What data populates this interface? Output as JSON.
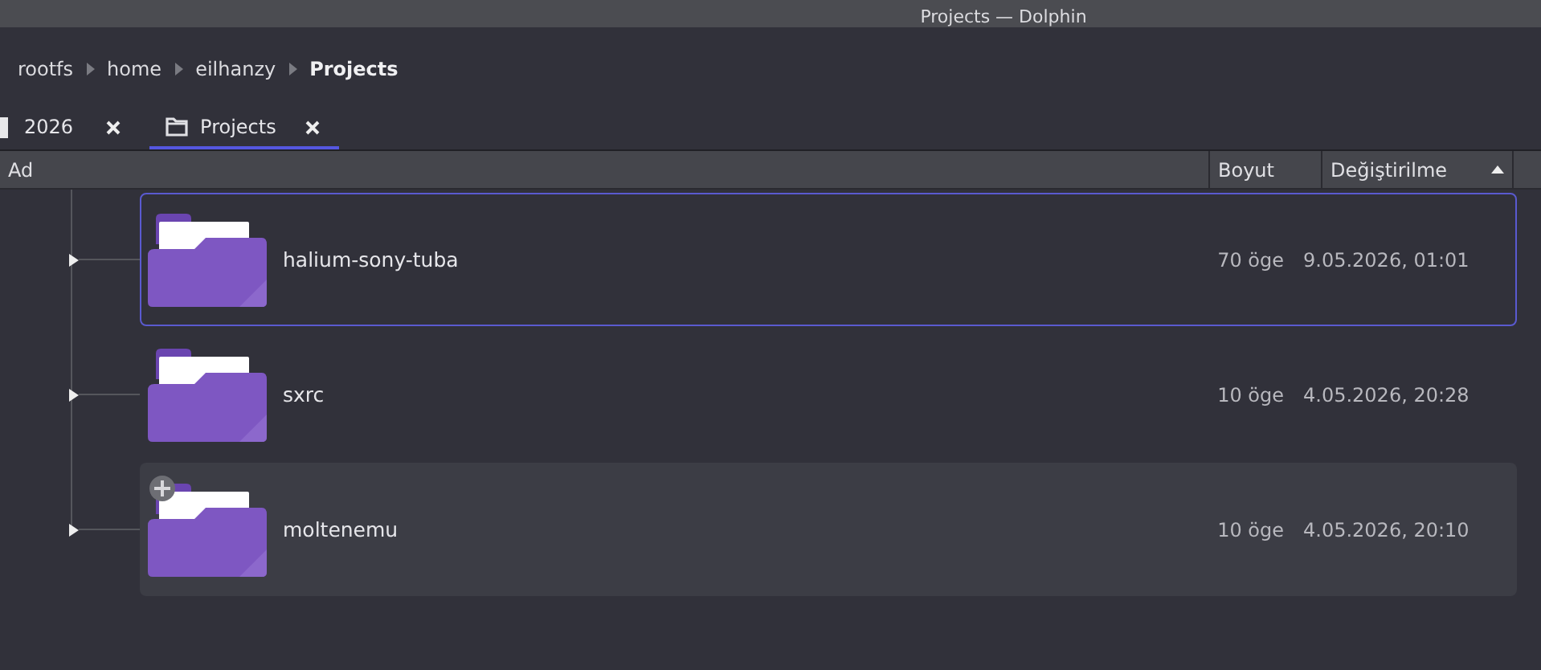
{
  "window": {
    "title": "Projects — Dolphin"
  },
  "breadcrumb": [
    {
      "label": "rootfs",
      "current": false
    },
    {
      "label": "home",
      "current": false
    },
    {
      "label": "eilhanzy",
      "current": false
    },
    {
      "label": "Projects",
      "current": true
    }
  ],
  "tabs": [
    {
      "label": "2026",
      "selected": false
    },
    {
      "label": "Projects",
      "selected": true
    }
  ],
  "columns": [
    {
      "label": "Ad",
      "sorted": false
    },
    {
      "label": "Boyut",
      "sorted": false
    },
    {
      "label": "Değiştirilme",
      "sorted": true
    }
  ],
  "rows": [
    {
      "name": "halium-sony-tuba",
      "size": "70 öge",
      "modified": "9.05.2026, 01:01",
      "focused": true,
      "hovered": false,
      "expanded": false
    },
    {
      "name": "sxrc",
      "size": "10 öge",
      "modified": "4.05.2026, 20:28",
      "focused": false,
      "hovered": false,
      "expanded": false
    },
    {
      "name": "moltenemu",
      "size": "10 öge",
      "modified": "4.05.2026, 20:10",
      "focused": false,
      "hovered": true,
      "expanded": false
    }
  ]
}
